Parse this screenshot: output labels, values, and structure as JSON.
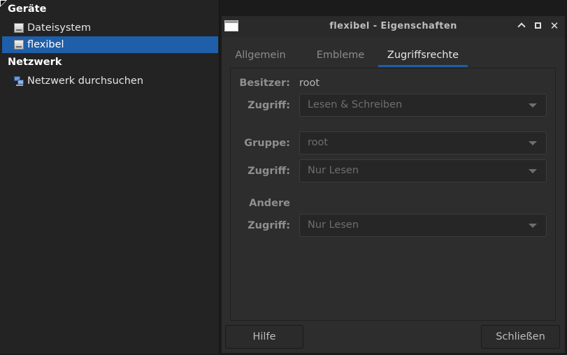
{
  "sidebar": {
    "devices_heading": "Geräte",
    "devices": [
      {
        "label": "Dateisystem",
        "icon": "drive-icon"
      },
      {
        "label": "flexibel",
        "icon": "drive-icon",
        "selected": true
      }
    ],
    "network_heading": "Netzwerk",
    "network": [
      {
        "label": "Netzwerk durchsuchen",
        "icon": "network-icon"
      }
    ]
  },
  "dialog": {
    "title": "flexibel - Eigenschaften",
    "tabs": [
      {
        "label": "Allgemein",
        "active": false
      },
      {
        "label": "Embleme",
        "active": false
      },
      {
        "label": "Zugriffsrechte",
        "active": true
      }
    ],
    "owner": {
      "label": "Besitzer:",
      "value": "root"
    },
    "owner_access": {
      "label": "Zugriff:",
      "value": "Lesen & Schreiben"
    },
    "group": {
      "label": "Gruppe:",
      "value": "root"
    },
    "group_access": {
      "label": "Zugriff:",
      "value": "Nur Lesen"
    },
    "others": {
      "label": "Andere"
    },
    "others_access": {
      "label": "Zugriff:",
      "value": "Nur Lesen"
    },
    "help_button": "Hilfe",
    "close_button": "Schließen"
  },
  "colors": {
    "accent": "#1f5ea8",
    "window_bg": "#2d2d2d",
    "sidebar_bg": "#232323"
  }
}
